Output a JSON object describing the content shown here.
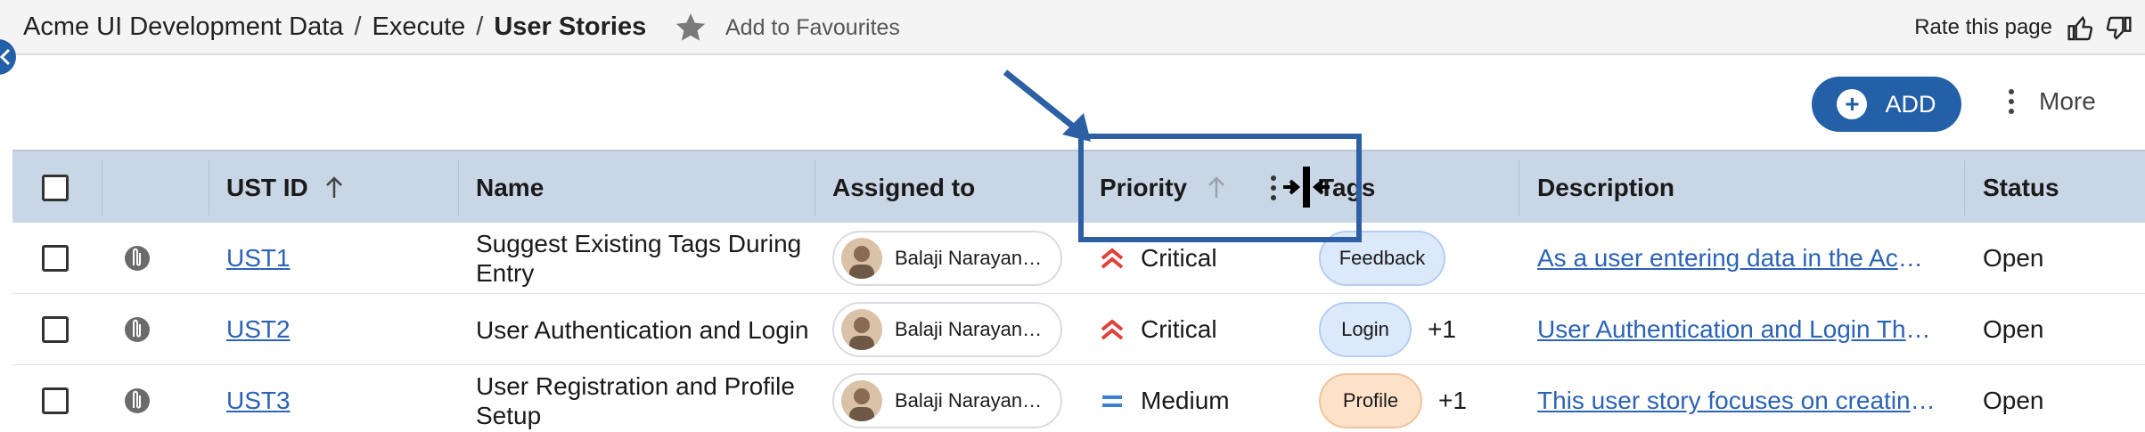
{
  "breadcrumb": {
    "items": [
      "Acme UI Development Data",
      "Execute"
    ],
    "current": "User Stories",
    "separator": "/"
  },
  "favourites": {
    "label": "Add to Favourites"
  },
  "rating": {
    "label": "Rate this page"
  },
  "toolbar": {
    "add_label": "ADD",
    "more_label": "More"
  },
  "table": {
    "headers": {
      "id": "UST ID",
      "name": "Name",
      "assigned": "Assigned to",
      "priority": "Priority",
      "tags": "Tags",
      "description": "Description",
      "status": "Status"
    },
    "rows": [
      {
        "id": "UST1",
        "name": "Suggest Existing Tags During Entry",
        "assignee": "Balaji Narayan…",
        "priority": "Critical",
        "tag": "Feedback",
        "extra_tags": "",
        "description": "As a user entering data in the Acme …",
        "status": "Open"
      },
      {
        "id": "UST2",
        "name": "User Authentication and Login",
        "assignee": "Balaji Narayan…",
        "priority": "Critical",
        "tag": "Login",
        "extra_tags": "+1",
        "description": "User Authentication and Login The …",
        "status": "Open"
      },
      {
        "id": "UST3",
        "name": "User Registration and Profile Setup",
        "assignee": "Balaji Narayan…",
        "priority": "Medium",
        "tag": "Profile",
        "extra_tags": "+1",
        "description": "This user story focuses on creating …",
        "status": "Open"
      }
    ]
  },
  "colors": {
    "accent": "#2360a8",
    "header_bg": "#c9d6e5",
    "critical": "#e0423a",
    "medium": "#3b82d6",
    "link": "#2c63b5",
    "tag_blue": "#dbe9fb",
    "tag_orange": "#fde2c9"
  },
  "icons": {
    "star": "star-icon",
    "thumbs_up": "thumbs-up-icon",
    "thumbs_down": "thumbs-down-icon",
    "attachment": "attachment-icon",
    "sort_up": "arrow-up-icon",
    "priority_critical": "chevrons-up-icon",
    "priority_medium": "equals-icon"
  }
}
